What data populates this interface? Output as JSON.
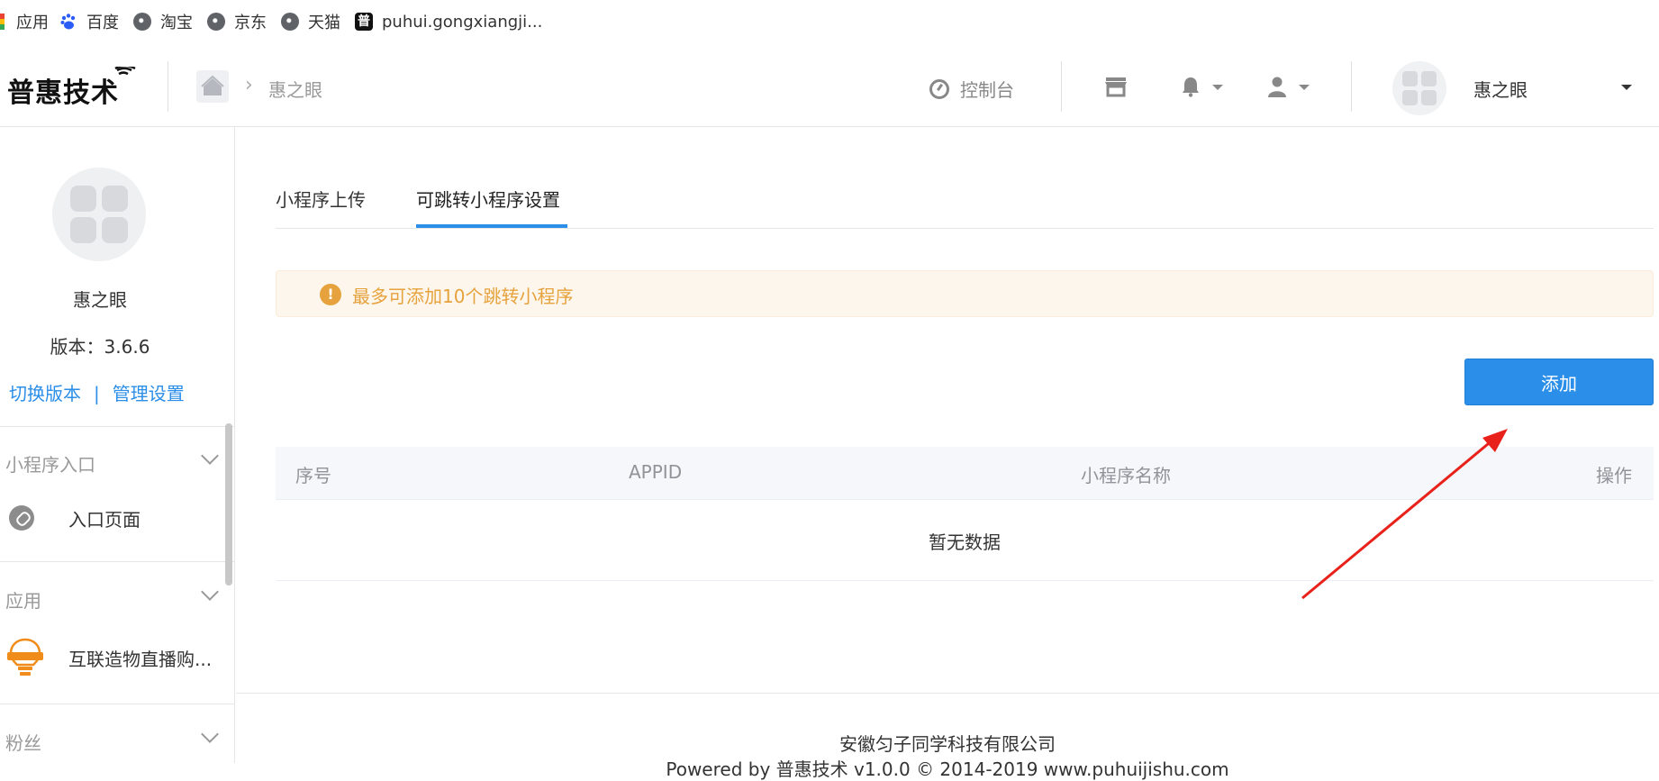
{
  "bookmarks": [
    {
      "label": "应用",
      "icon": "apps-grid-icon"
    },
    {
      "label": "百度",
      "icon": "baidu-paw-icon"
    },
    {
      "label": "淘宝",
      "icon": "globe-icon"
    },
    {
      "label": "京东",
      "icon": "globe-icon"
    },
    {
      "label": "天猫",
      "icon": "globe-icon"
    },
    {
      "label": "puhui.gongxiangji...",
      "icon": "puhui-icon",
      "icon_text": "普"
    }
  ],
  "header": {
    "logo": "普惠技术",
    "breadcrumb": "惠之眼",
    "console_label": "控制台",
    "account_name": "惠之眼"
  },
  "sidebar": {
    "name": "惠之眼",
    "version_label": "版本：3.6.6",
    "switch_version": "切换版本",
    "divider": "|",
    "manage_settings": "管理设置",
    "sections": [
      {
        "title": "小程序入口",
        "item": "入口页面"
      },
      {
        "title": "应用",
        "item": "互联造物直播购..."
      },
      {
        "title": "粉丝"
      }
    ]
  },
  "tabs": [
    "小程序上传",
    "可跳转小程序设置"
  ],
  "active_tab": 1,
  "alert": {
    "icon_text": "!",
    "text": "最多可添加10个跳转小程序"
  },
  "add_button": "添加",
  "table": {
    "headers": [
      "序号",
      "APPID",
      "小程序名称",
      "操作"
    ],
    "empty_text": "暂无数据"
  },
  "footer": {
    "company": "安徽匀子同学科技有限公司",
    "powered": "Powered by 普惠技术 v1.0.0 © 2014-2019 www.puhuijishu.com"
  },
  "colors": {
    "primary": "#2b8ee8",
    "warning": "#e6a23c",
    "annotation_arrow": "#e8211a"
  }
}
